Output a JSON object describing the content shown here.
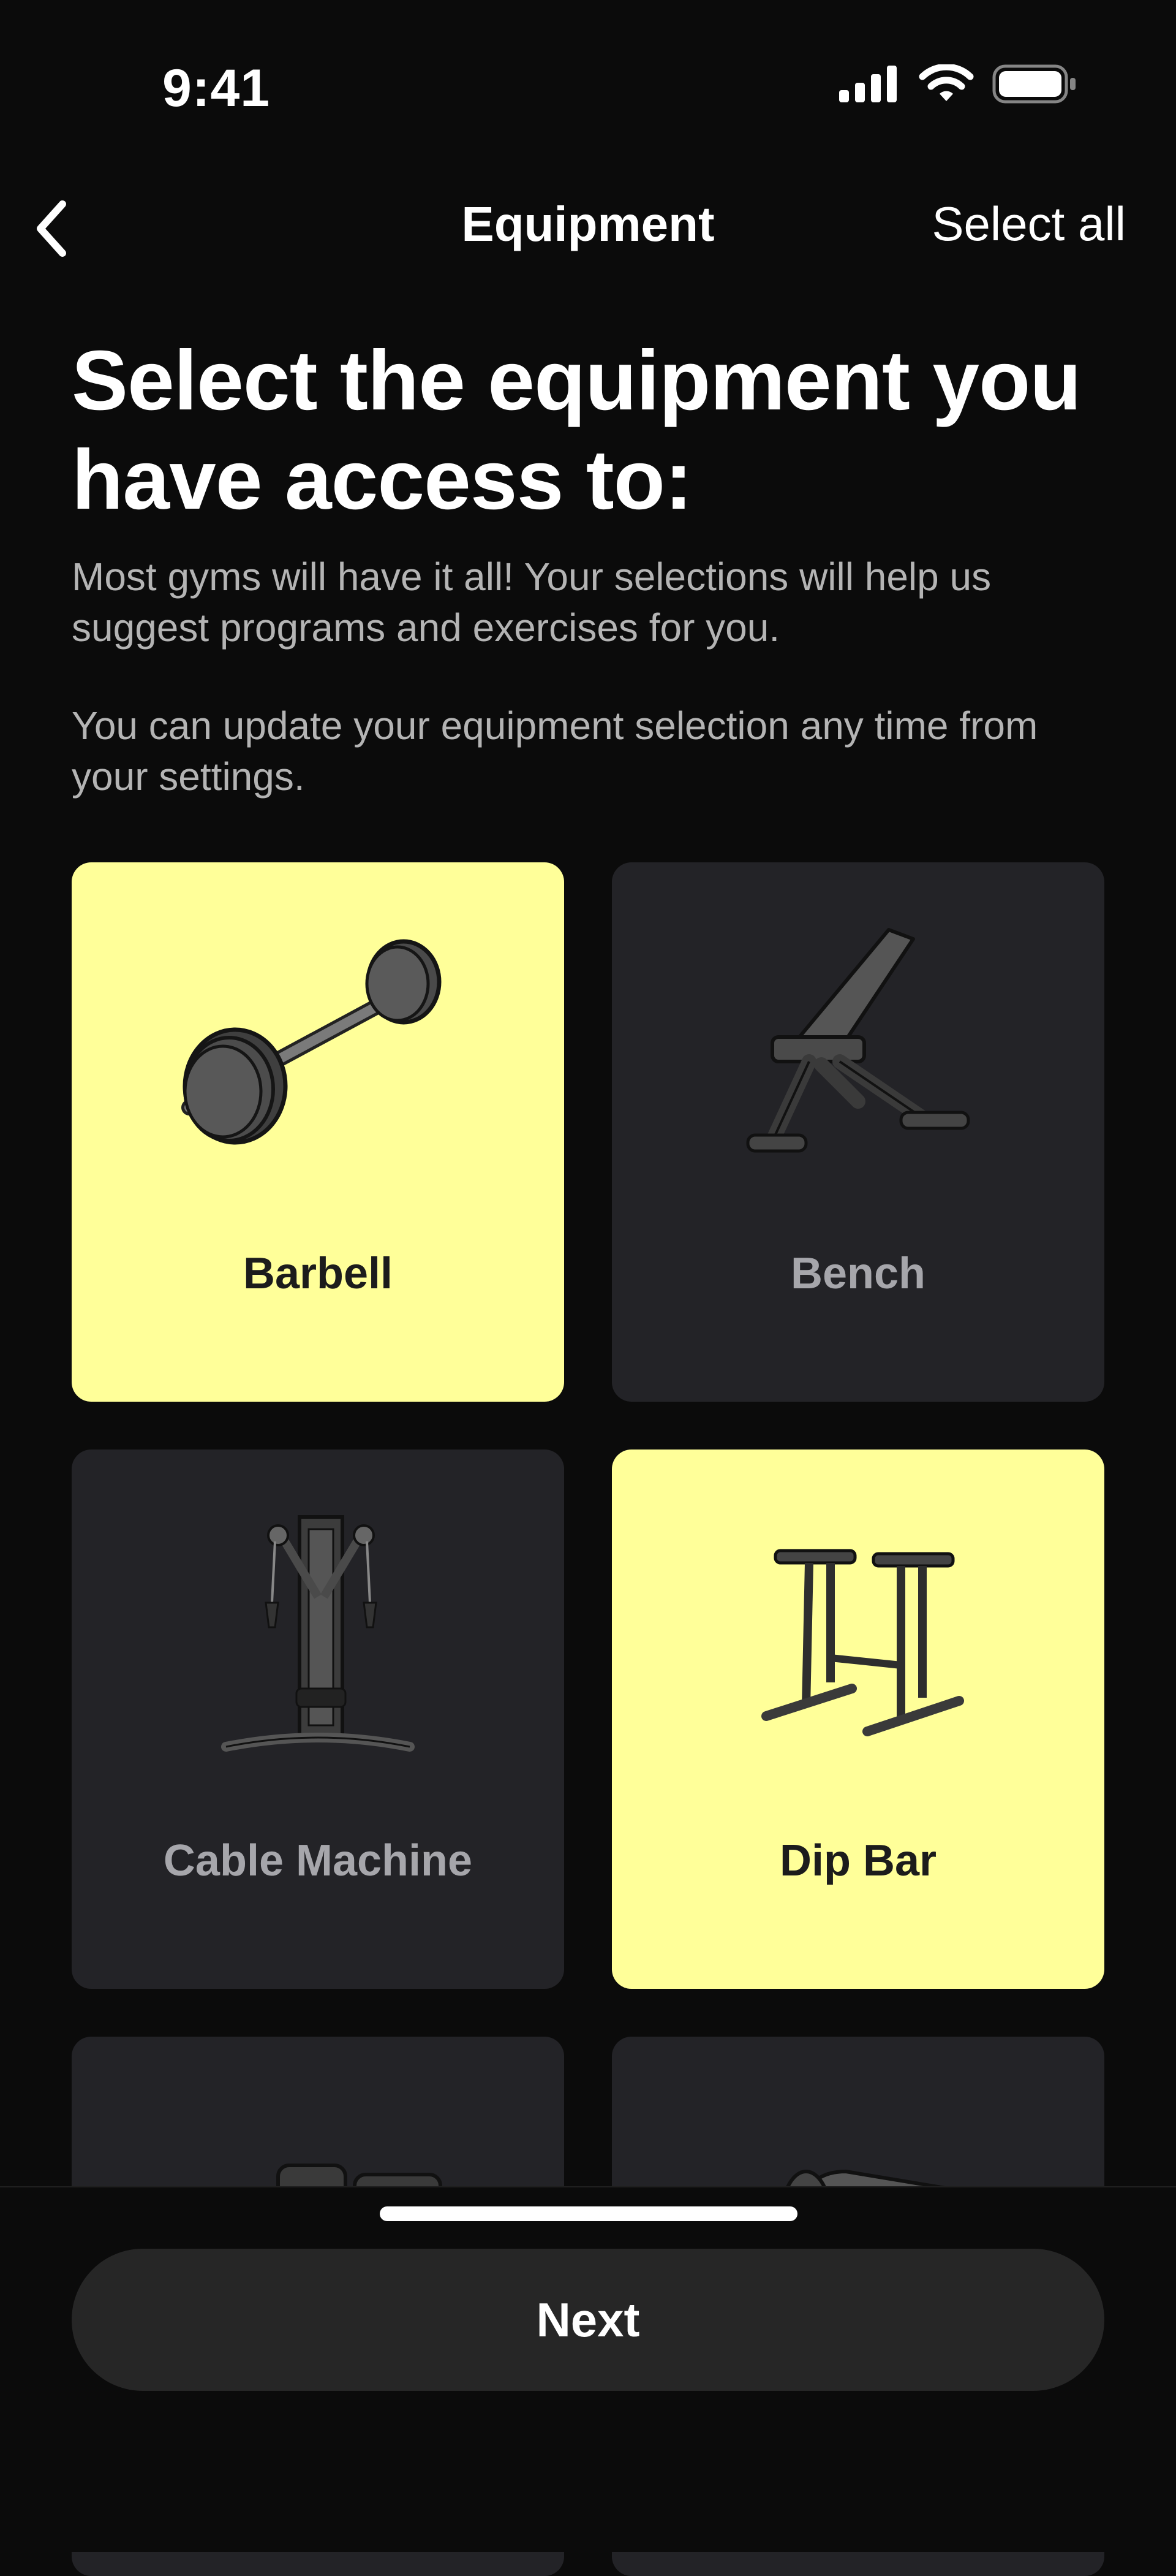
{
  "status_bar": {
    "time": "9:41",
    "icons": [
      "cellular-signal-icon",
      "wifi-icon",
      "battery-icon"
    ]
  },
  "nav": {
    "title": "Equipment",
    "select_all_label": "Select all",
    "back_icon": "chevron-left-icon"
  },
  "heading": "Select the equipment you have access to:",
  "description_1": "Most gyms will have it all! Your selections will help us suggest programs and exercises for you.",
  "description_2": "You can update your equipment selection any time from your settings.",
  "equipment": [
    {
      "label": "Barbell",
      "selected": true,
      "icon": "barbell-icon"
    },
    {
      "label": "Bench",
      "selected": false,
      "icon": "bench-icon"
    },
    {
      "label": "Cable Machine",
      "selected": false,
      "icon": "cable-machine-icon"
    },
    {
      "label": "Dip Bar",
      "selected": true,
      "icon": "dip-bar-icon"
    },
    {
      "label": "",
      "selected": false,
      "icon": "dumbbell-icon"
    },
    {
      "label": "",
      "selected": false,
      "icon": "foam-roller-icon"
    }
  ],
  "next_label": "Next",
  "colors": {
    "background": "#0b0b0b",
    "card": "#232327",
    "card_selected": "#ffff99",
    "button": "#262626"
  }
}
